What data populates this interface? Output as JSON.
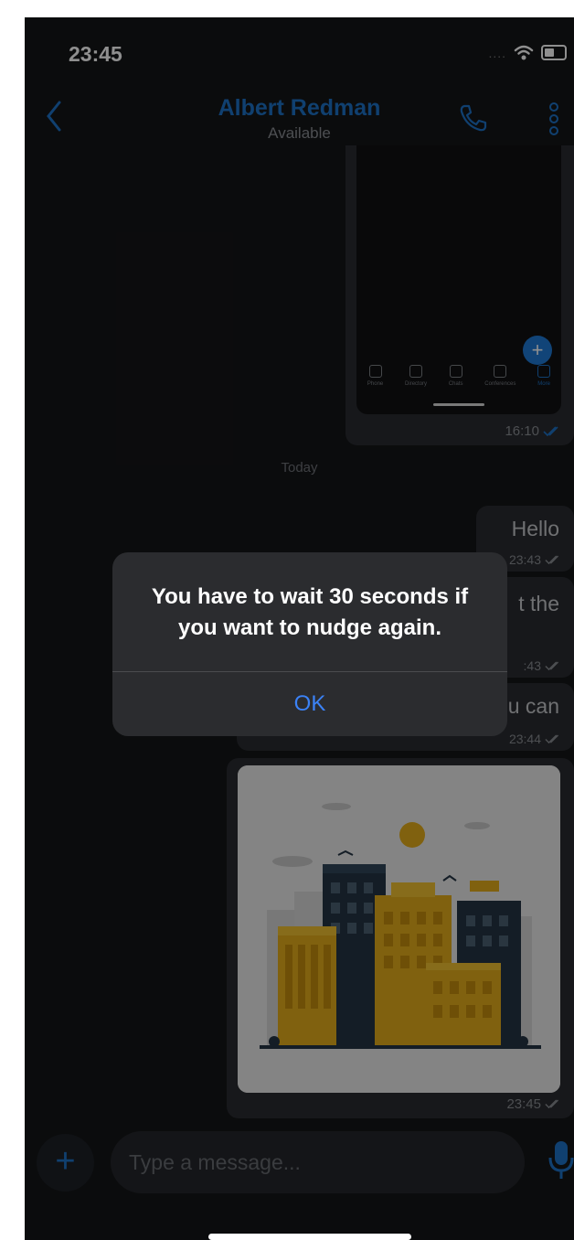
{
  "status_bar": {
    "time": "23:45",
    "signal": "....",
    "battery_icon": "battery-icon",
    "wifi_icon": "wifi-icon"
  },
  "header": {
    "title": "Albert Redman",
    "subtitle": "Available",
    "back_icon": "chevron-left-icon",
    "call_icon": "phone-icon",
    "more_icon": "vertical-dots-icon"
  },
  "screenshot_message": {
    "fab_label": "+",
    "tabs": [
      {
        "label": "Phone"
      },
      {
        "label": "Directory"
      },
      {
        "label": "Chats"
      },
      {
        "label": "Conferences"
      },
      {
        "label": "More"
      }
    ],
    "time": "16:10"
  },
  "day_separator": "Today",
  "messages": [
    {
      "text": "Hello",
      "time": "23:43"
    },
    {
      "text": "t the",
      "time": ":43"
    },
    {
      "text": "u can",
      "time": "23:44"
    }
  ],
  "image_message": {
    "time": "23:45"
  },
  "composer": {
    "add_label": "+",
    "placeholder": "Type a message...",
    "mic_icon": "microphone-icon"
  },
  "alert": {
    "message": "You have to wait 30 seconds if you want to nudge again.",
    "ok_label": "OK"
  },
  "colors": {
    "accent": "#1e73c8",
    "background": "#151618",
    "bubble": "#2a2c30",
    "alert_button": "#3b82f6",
    "image_yellow": "#e4ad1c",
    "image_navy": "#253545"
  }
}
